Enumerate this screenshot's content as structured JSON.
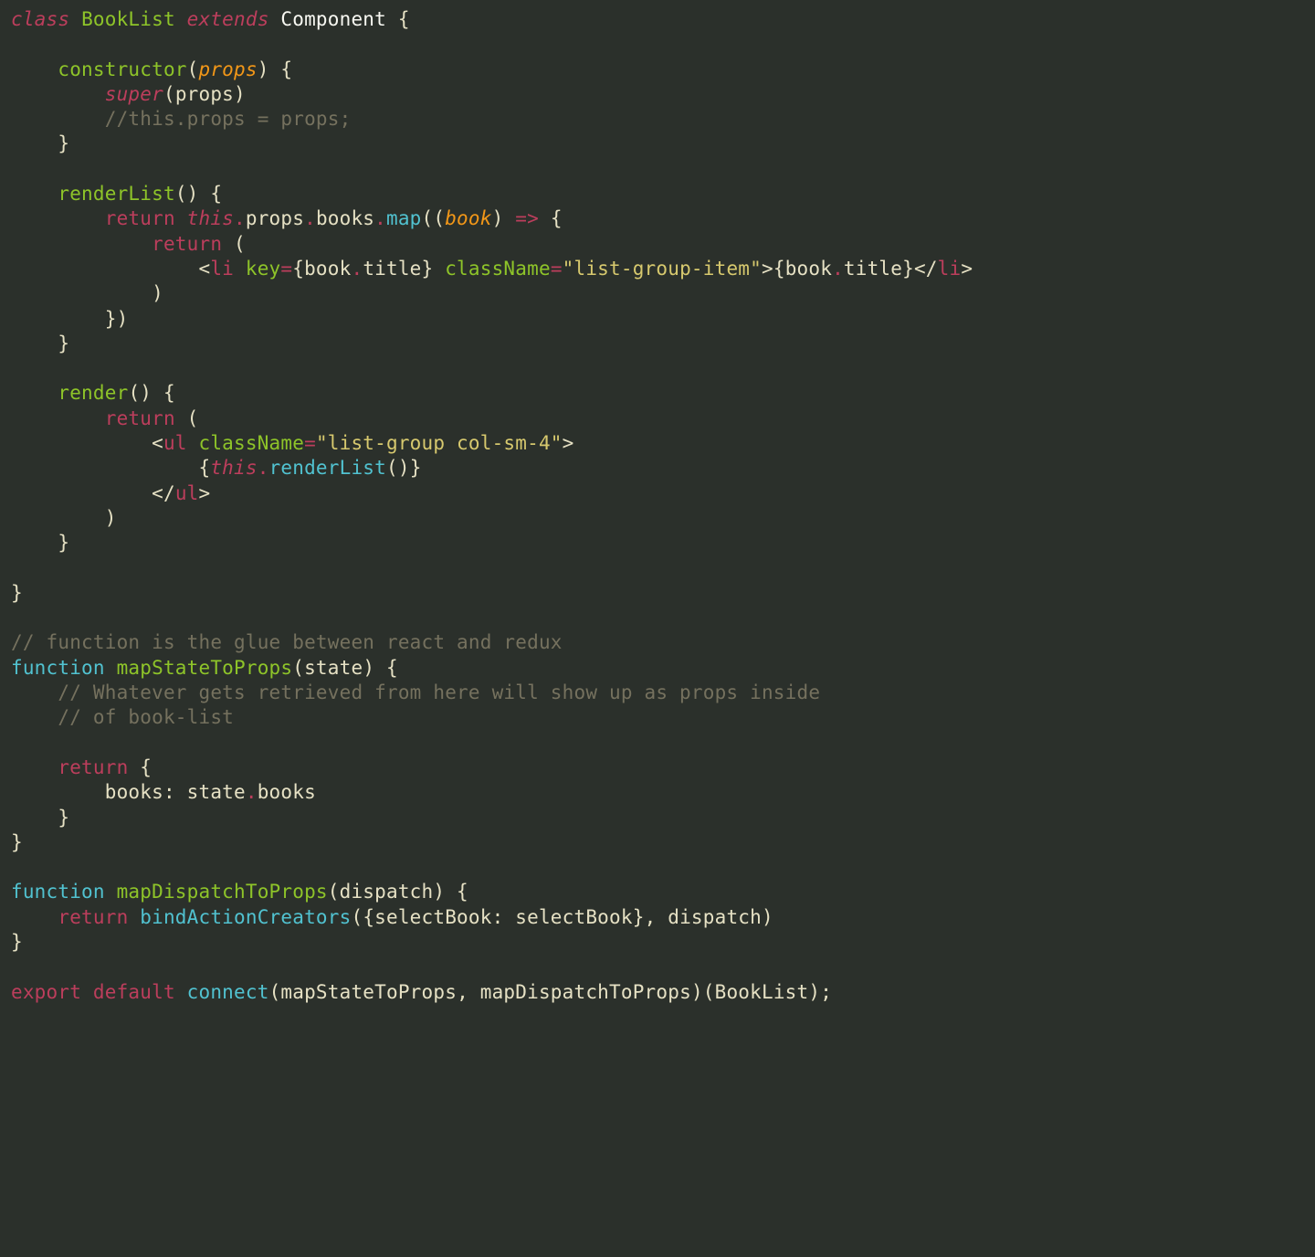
{
  "code": {
    "l1": {
      "class_kw": "class",
      "name": "BookList",
      "extends_kw": "extends",
      "component": "Component",
      "brace_open": " {"
    },
    "l2": "",
    "l3": {
      "ctor": "constructor",
      "paren_open": "(",
      "props": "props",
      "paren_close": ")",
      "brace": " {"
    },
    "l4": {
      "super": "super",
      "paren_open": "(",
      "props": "props",
      "paren_close": ")"
    },
    "l5": "//this.props = props;",
    "l6": "}",
    "l7": "",
    "l8": {
      "name": "renderList",
      "parens": "()",
      "brace": " {"
    },
    "l9": {
      "return": "return",
      "this": "this",
      "dot1": ".",
      "props": "props",
      "dot2": ".",
      "books": "books",
      "dot3": ".",
      "map": "map",
      "open": "((",
      "book": "book",
      "close": ")",
      "arrow": " => ",
      "brace": "{"
    },
    "l10": {
      "return": "return",
      "paren": " ("
    },
    "l11": {
      "open": "<",
      "tag": "li",
      "sp": " ",
      "attr1": "key",
      "eq1": "=",
      "val1_open": "{",
      "val1_obj": "book",
      "val1_dot": ".",
      "val1_prop": "title",
      "val1_close": "}",
      "sp2": " ",
      "attr2": "className",
      "eq2": "=",
      "val2": "\"list-group-item\"",
      "close1": ">",
      "text_open": "{",
      "text_obj": "book",
      "text_dot": ".",
      "text_prop": "title",
      "text_close": "}",
      "close_open": "</",
      "close_tag": "li",
      "close_close": ">"
    },
    "l12": ")",
    "l13": "})",
    "l14": "}",
    "l15": "",
    "l16": {
      "name": "render",
      "parens": "()",
      "brace": " {"
    },
    "l17": "return (",
    "l18": {
      "open": "<",
      "tag": "ul",
      "sp": " ",
      "attr": "className",
      "eq": "=",
      "val": "\"list-group col-sm-4\"",
      "close": ">"
    },
    "l19": {
      "brace_open": "{",
      "this": "this",
      "dot": ".",
      "fn": "renderList",
      "parens": "()",
      "brace_close": "}"
    },
    "l20": {
      "open": "</",
      "tag": "ul",
      "close": ">"
    },
    "l21": ")",
    "l22": "}",
    "l23": "",
    "l24": "}",
    "l25": "",
    "l26": "// function is the glue between react and redux",
    "l27": {
      "fn_kw": "function",
      "name": "mapStateToProps",
      "open": "(",
      "param": "state",
      "close": ")",
      "brace": " {"
    },
    "l28": "// Whatever gets retrieved from here will show up as props inside",
    "l29": "// of book-list",
    "l30": "",
    "l31": {
      "return": "return",
      "brace": " {"
    },
    "l32": {
      "key": "books",
      "colon": ": ",
      "obj": "state",
      "dot": ".",
      "prop": "books"
    },
    "l33": "}",
    "l34": "}",
    "l35": "",
    "l36": {
      "fn_kw": "function",
      "name": "mapDispatchToProps",
      "open": "(",
      "param": "dispatch",
      "close": ")",
      "brace": " {"
    },
    "l37": {
      "return": "return",
      "fn": "bindActionCreators",
      "open": "(",
      "brace_open": "{",
      "key": "selectBook",
      "colon": ": ",
      "val": "selectBook",
      "brace_close": "}",
      "comma": ", ",
      "param": "dispatch",
      "close": ")"
    },
    "l38": "}",
    "l39": "",
    "l40": {
      "export": "export",
      "default": "default",
      "connect": "connect",
      "open": "(",
      "p1": "mapStateToProps",
      "comma": ", ",
      "p2": "mapDispatchToProps",
      "close": ")",
      "open2": "(",
      "cls": "BookList",
      "close2": ")",
      "semi": ";"
    }
  }
}
